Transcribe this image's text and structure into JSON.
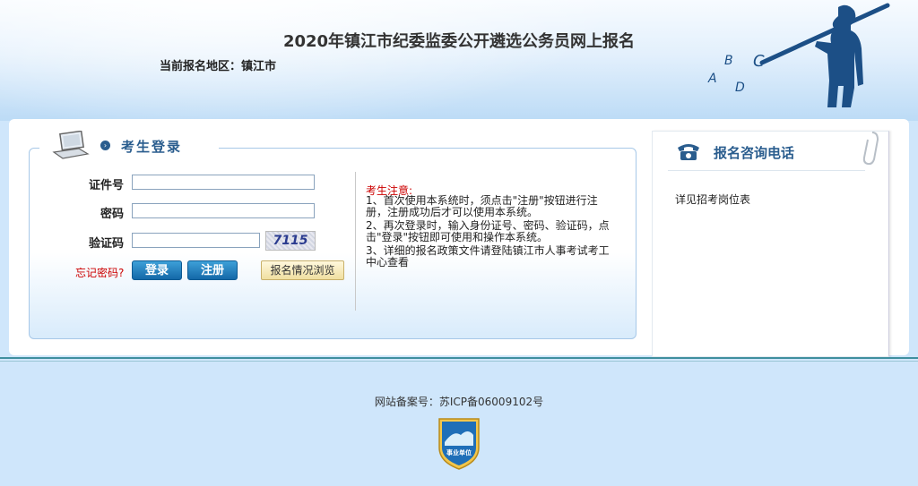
{
  "header": {
    "title": "2020年镇江市纪委监委公开遴选公务员网上报名",
    "region_label": "当前报名地区：镇江市",
    "mascot_letters": [
      "A",
      "B",
      "C",
      "D"
    ]
  },
  "login": {
    "title": "考生登录",
    "id_label": "证件号",
    "id_value": "",
    "password_label": "密码",
    "password_value": "",
    "captcha_label": "验证码",
    "captcha_value": "",
    "captcha_text": "7115",
    "forgot_label": "忘记密码?",
    "login_button": "登录",
    "register_button": "注册",
    "browse_button": "报名情况浏览"
  },
  "notice": {
    "title": "考生注意:",
    "lines": [
      "1、首次使用本系统时，须点击\"注册\"按钮进行注册，注册成功后才可以使用本系统。",
      "2、再次登录时，输入身份证号、密码、验证码，点击\"登录\"按钮即可使用和操作本系统。",
      "3、详细的报名政策文件请登陆镇江市人事考试考工中心查看"
    ]
  },
  "contact": {
    "title": "报名咨询电话",
    "text": "详见招考岗位表"
  },
  "footer": {
    "icp": "网站备案号：苏ICP备06009102号",
    "badge_text": "事业单位"
  },
  "colors": {
    "accent": "#2a5d8e",
    "button_blue": "#1e7bbf",
    "warning_red": "#cc0000"
  }
}
